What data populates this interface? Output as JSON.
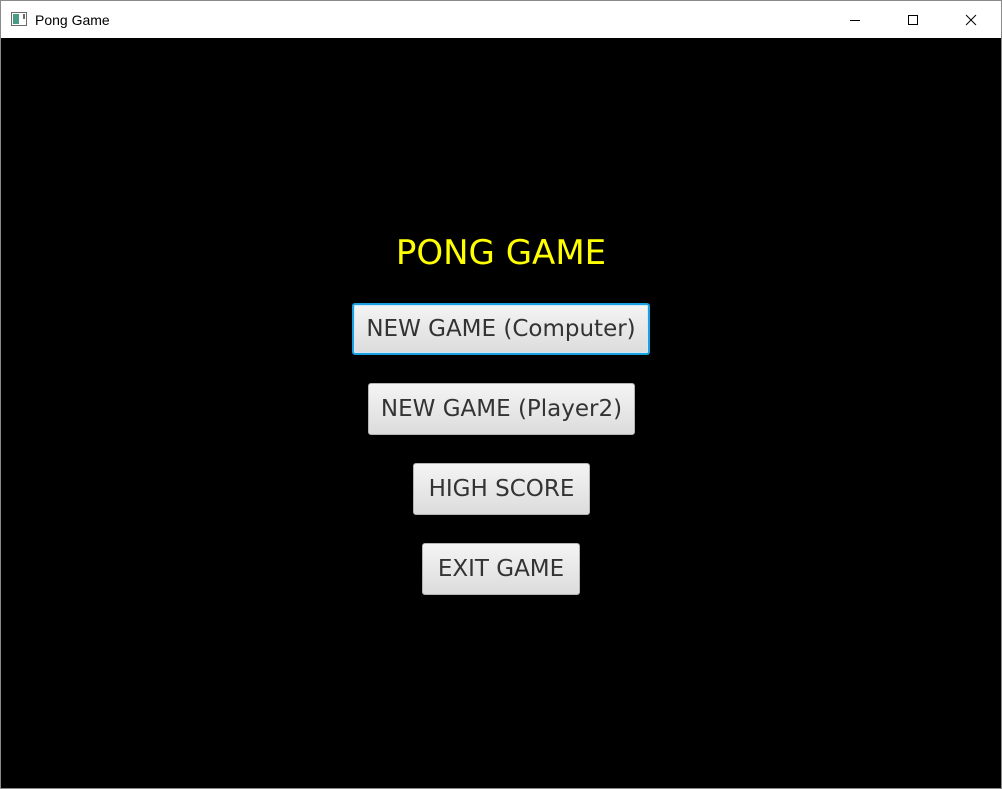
{
  "window": {
    "title": "Pong Game",
    "controls": {
      "minimize": "minimize-icon",
      "maximize": "maximize-icon",
      "close": "close-icon"
    }
  },
  "menu": {
    "title": "PONG GAME",
    "title_color": "#ffff00",
    "background_color": "#000000",
    "buttons": [
      {
        "label": "NEW GAME (Computer)",
        "focused": true
      },
      {
        "label": "NEW GAME (Player2)",
        "focused": false
      },
      {
        "label": "HIGH SCORE",
        "focused": false
      },
      {
        "label": "EXIT GAME",
        "focused": false
      }
    ]
  }
}
